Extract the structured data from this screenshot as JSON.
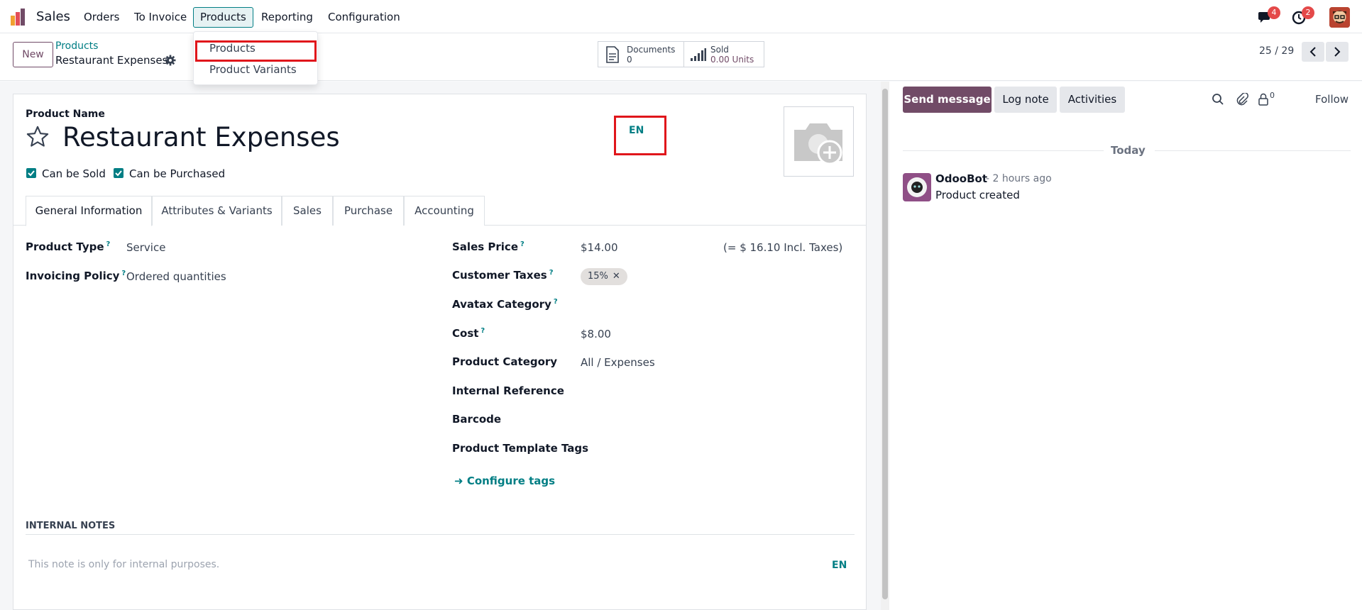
{
  "topbar": {
    "app_name": "Sales",
    "menu": [
      "Orders",
      "To Invoice",
      "Products",
      "Reporting",
      "Configuration"
    ],
    "messages_badge": "4",
    "activities_badge": "2"
  },
  "products_dropdown": {
    "items": [
      "Products",
      "Product Variants"
    ]
  },
  "control_panel": {
    "new_label": "New",
    "breadcrumb_parent": "Products",
    "breadcrumb_current": "Restaurant Expenses",
    "documents_label": "Documents",
    "documents_value": "0",
    "sold_label": "Sold",
    "sold_value": "0.00 Units",
    "pager": "25 / 29"
  },
  "form": {
    "product_name_label": "Product Name",
    "product_name": "Restaurant Expenses",
    "lang_badge": "EN",
    "can_be_sold": "Can be Sold",
    "can_be_purchased": "Can be Purchased",
    "tabs": [
      "General Information",
      "Attributes & Variants",
      "Sales",
      "Purchase",
      "Accounting"
    ],
    "left_fields": [
      {
        "label": "Product Type",
        "value": "Service",
        "help": "?"
      },
      {
        "label": "Invoicing Policy",
        "value": "Ordered quantities",
        "help": "?"
      }
    ],
    "sales_price_label": "Sales Price",
    "sales_price": "$14.00",
    "sales_price_incl": "(= $ 16.10 Incl. Taxes)",
    "customer_taxes_label": "Customer Taxes",
    "customer_tax_tag": "15%",
    "avatax_label": "Avatax Category",
    "cost_label": "Cost",
    "cost_value": "$8.00",
    "category_label": "Product Category",
    "category_value": "All / Expenses",
    "internal_ref_label": "Internal Reference",
    "barcode_label": "Barcode",
    "tags_label": "Product Template Tags",
    "configure_tags": "Configure tags",
    "help_mark": "?",
    "internal_notes_title": "INTERNAL NOTES",
    "internal_notes_placeholder": "This note is only for internal purposes.",
    "notes_lang": "EN"
  },
  "chatter": {
    "send_message": "Send message",
    "log_note": "Log note",
    "activities": "Activities",
    "followers_count": "0",
    "follow": "Follow",
    "today": "Today",
    "author": "OdooBot",
    "time": "- 2 hours ago",
    "message": "Product created"
  },
  "colors": {
    "brand": "#714b67",
    "accent": "#017e84",
    "highlight": "#e0161b"
  }
}
